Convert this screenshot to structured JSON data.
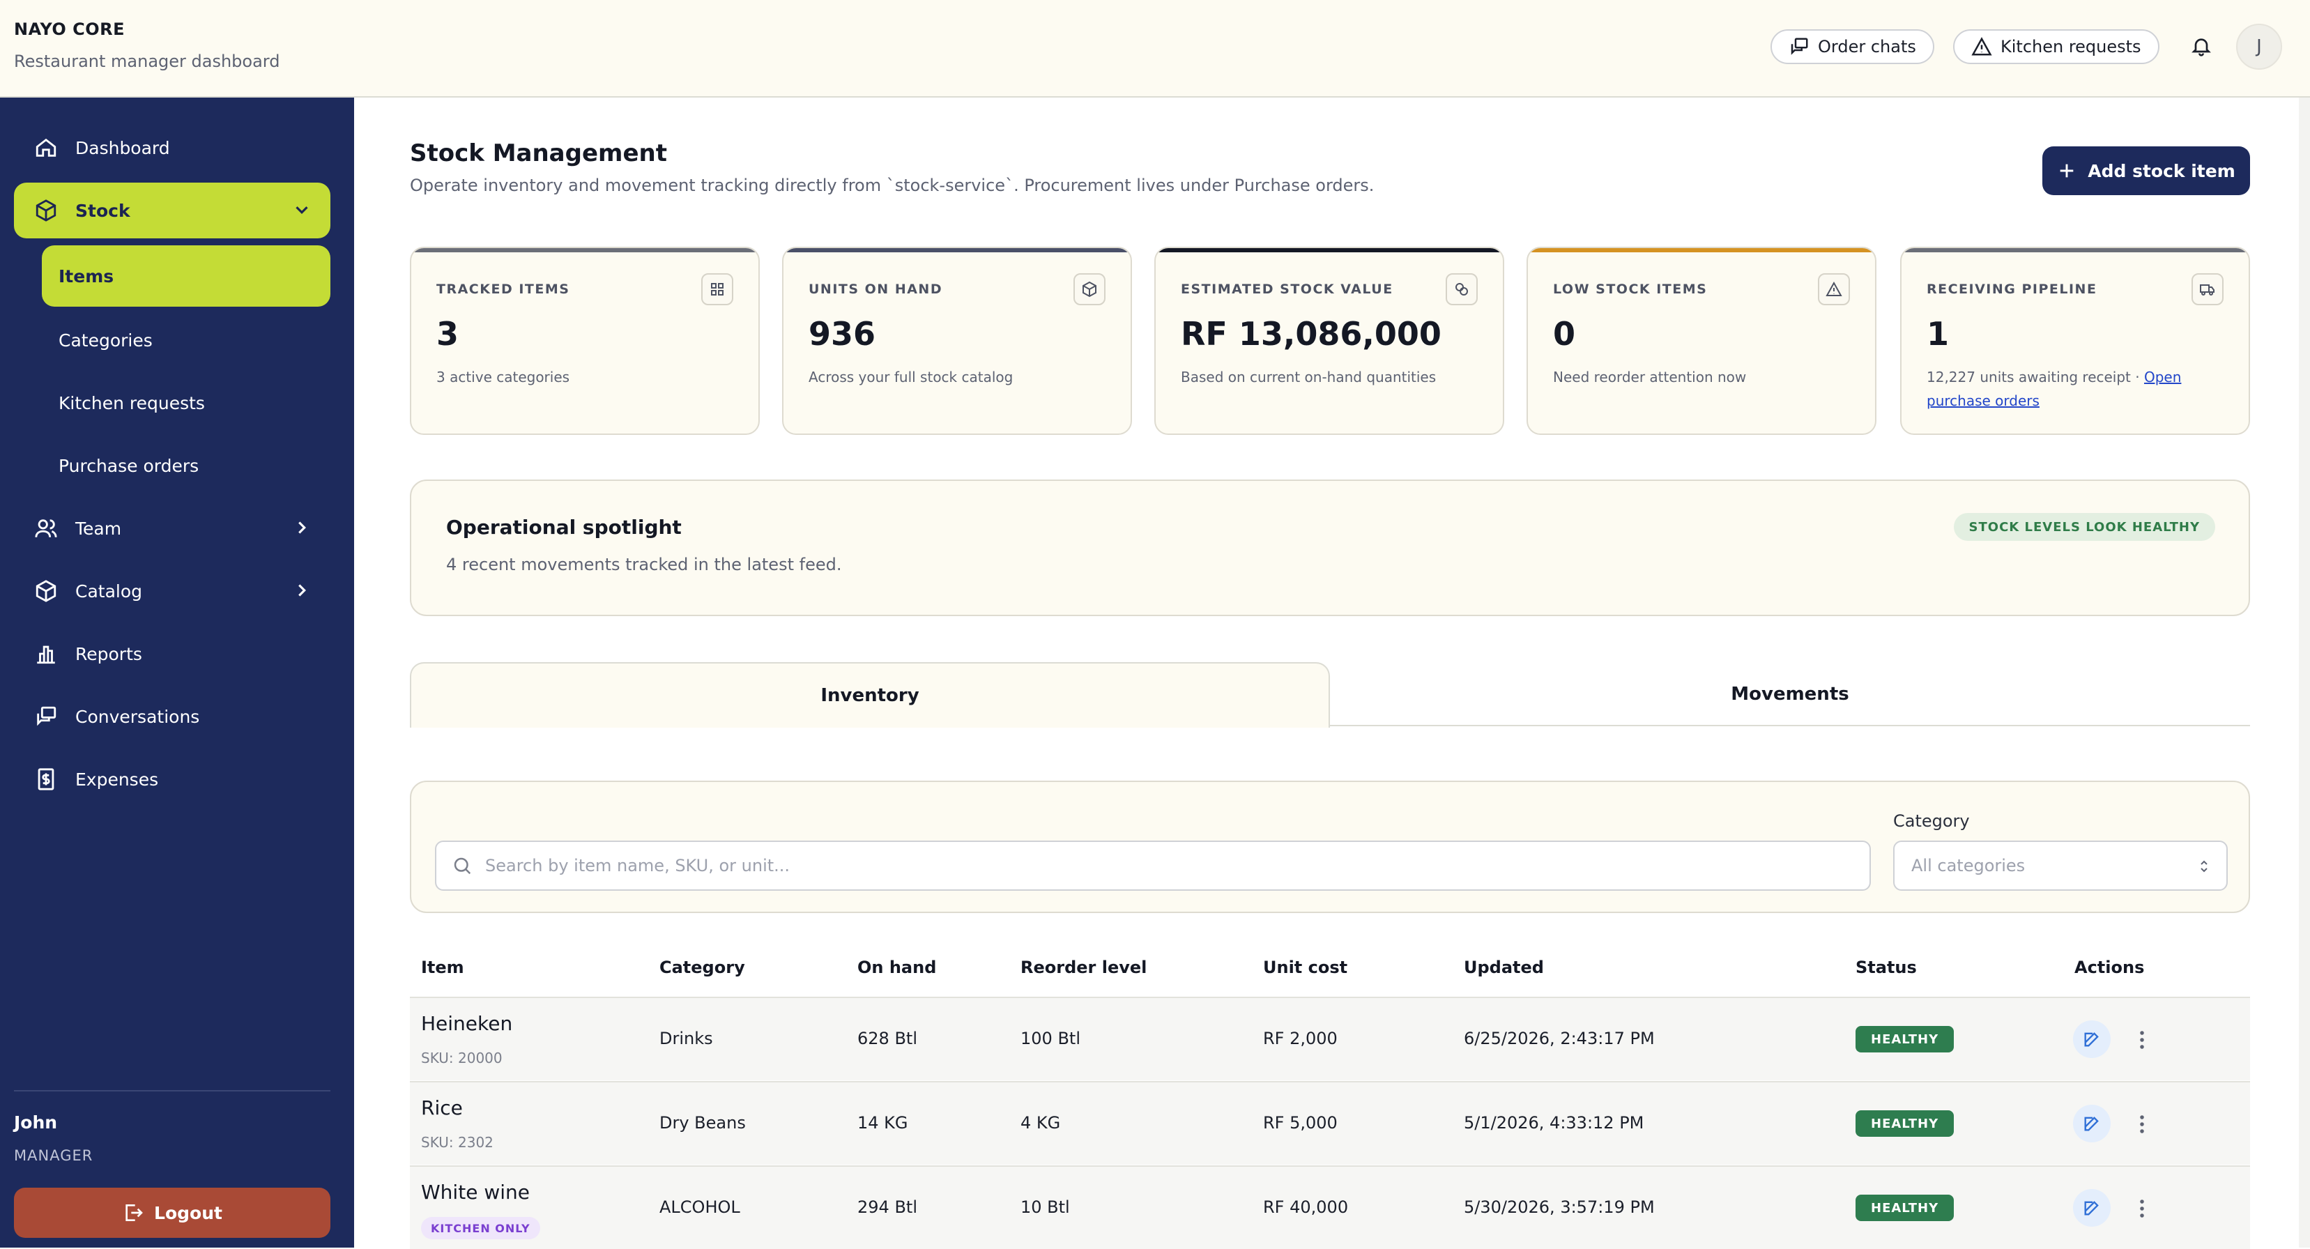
{
  "app": {
    "brand": "NAYO CORE",
    "subtitle": "Restaurant manager dashboard"
  },
  "header": {
    "order_chats": "Order chats",
    "kitchen_requests": "Kitchen requests",
    "avatar_initial": "J"
  },
  "sidebar": {
    "items": [
      {
        "label": "Dashboard",
        "icon": "home-icon"
      },
      {
        "label": "Stock",
        "icon": "box-icon",
        "expanded": true
      },
      {
        "label": "Team",
        "icon": "users-icon"
      },
      {
        "label": "Catalog",
        "icon": "package-icon"
      },
      {
        "label": "Reports",
        "icon": "bar-chart-icon"
      },
      {
        "label": "Conversations",
        "icon": "chat-icon"
      },
      {
        "label": "Expenses",
        "icon": "receipt-icon"
      }
    ],
    "stock_sub": [
      "Items",
      "Categories",
      "Kitchen requests",
      "Purchase orders"
    ],
    "user": {
      "name": "John",
      "role": "MANAGER"
    },
    "logout": "Logout"
  },
  "page": {
    "title": "Stock Management",
    "subtitle": "Operate inventory and movement tracking directly from `stock-service`. Procurement lives under Purchase orders.",
    "add_button": "Add stock item"
  },
  "stats": [
    {
      "label": "TRACKED ITEMS",
      "value": "3",
      "desc": "3 active categories",
      "icon": "grid-icon",
      "accent": "#6b6e78"
    },
    {
      "label": "UNITS ON HAND",
      "value": "936",
      "desc": "Across your full stock catalog",
      "icon": "box-icon",
      "accent": "#4a5068"
    },
    {
      "label": "ESTIMATED STOCK VALUE",
      "value": "RF 13,086,000",
      "desc": "Based on current on-hand quantities",
      "icon": "coins-icon",
      "accent": "#141824"
    },
    {
      "label": "LOW STOCK ITEMS",
      "value": "0",
      "desc": "Need reorder attention now",
      "icon": "alert-icon",
      "accent": "#d59222"
    },
    {
      "label": "RECEIVING PIPELINE",
      "value": "1",
      "desc_prefix": "12,227 units awaiting receipt · ",
      "desc_link": "Open purchase orders",
      "icon": "truck-icon",
      "accent": "#6b6e78"
    }
  ],
  "spotlight": {
    "title": "Operational spotlight",
    "subtitle": "4 recent movements tracked in the latest feed.",
    "badge": "STOCK LEVELS LOOK HEALTHY"
  },
  "tabs": [
    "Inventory",
    "Movements"
  ],
  "filters": {
    "search_placeholder": "Search by item name, SKU, or unit...",
    "category_label": "Category",
    "category_value": "All categories"
  },
  "table": {
    "headers": [
      "Item",
      "Category",
      "On hand",
      "Reorder level",
      "Unit cost",
      "Updated",
      "Status",
      "Actions"
    ],
    "rows": [
      {
        "name": "Heineken",
        "sku": "SKU: 20000",
        "category": "Drinks",
        "on_hand": "628 Btl",
        "reorder": "100 Btl",
        "unit_cost": "RF 2,000",
        "updated": "6/25/2026, 2:43:17 PM",
        "status": "HEALTHY"
      },
      {
        "name": "Rice",
        "sku": "SKU: 2302",
        "category": "Dry Beans",
        "on_hand": "14 KG",
        "reorder": "4 KG",
        "unit_cost": "RF 5,000",
        "updated": "5/1/2026, 4:33:12 PM",
        "status": "HEALTHY"
      },
      {
        "name": "White wine",
        "badge": "KITCHEN ONLY",
        "category": "ALCOHOL",
        "on_hand": "294 Btl",
        "reorder": "10 Btl",
        "unit_cost": "RF 40,000",
        "updated": "5/30/2026, 3:57:19 PM",
        "status": "HEALTHY"
      }
    ]
  },
  "colors": {
    "sidebar": "#1d2a5c",
    "accent": "#c4dc36",
    "healthy": "#2e7d4f",
    "logout": "#a94a36"
  }
}
